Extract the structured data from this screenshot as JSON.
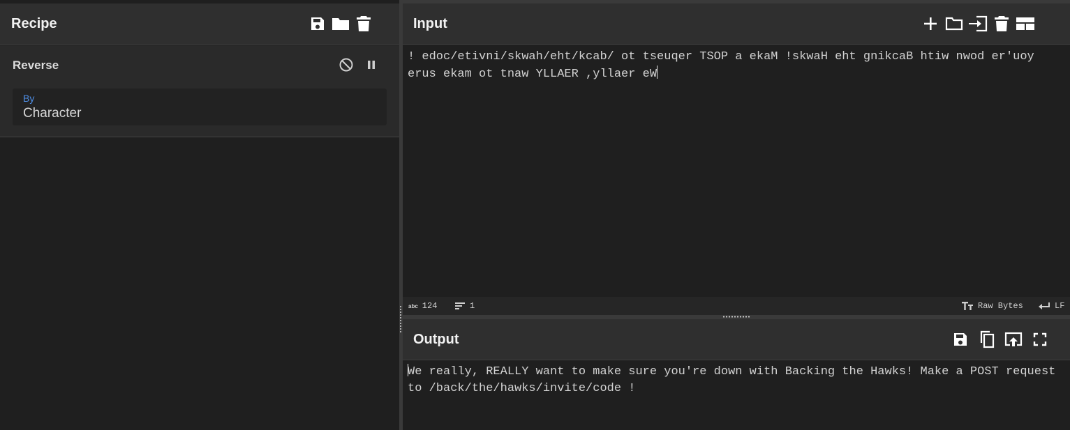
{
  "recipe": {
    "title": "Recipe",
    "icons": [
      "save-icon",
      "folder-icon",
      "trash-icon"
    ],
    "operation": {
      "name": "Reverse",
      "controls": [
        "disable-icon",
        "pause-icon"
      ],
      "field_label": "By",
      "field_value": "Character"
    }
  },
  "input": {
    "title": "Input",
    "icons": [
      "plus-icon",
      "folder-icon",
      "import-icon",
      "trash-icon",
      "layout-icon"
    ],
    "text": "! edoc/etivni/skwah/eht/kcab/ ot tseuqer TSOP a ekaM !skwaH eht gnikcaB htiw nwod er'uoy erus ekam ot tnaw YLLAER ,yllaer eW",
    "status": {
      "char_count_label": "abc",
      "char_count": "124",
      "line_count": "1",
      "encoding": "Raw Bytes",
      "eol": "LF"
    }
  },
  "output": {
    "title": "Output",
    "icons": [
      "save-icon",
      "copy-icon",
      "replace-input-icon",
      "maximize-icon"
    ],
    "text": "We really, REALLY want to make sure you're down with Backing the Hawks! Make a POST request to /back/the/hawks/invite/code !"
  },
  "colors": {
    "background": "#1f1f1f",
    "header": "#2f2f2f",
    "field_label": "#4f8fe8"
  }
}
